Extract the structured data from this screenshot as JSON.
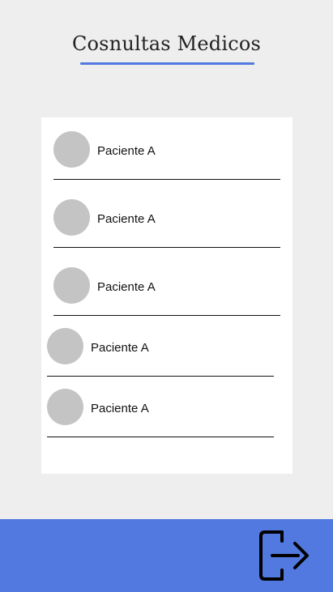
{
  "header": {
    "title": "Cosnultas Medicos"
  },
  "patients": [
    {
      "name": "Paciente A"
    },
    {
      "name": "Paciente A"
    },
    {
      "name": "Paciente A"
    },
    {
      "name": "Paciente A"
    },
    {
      "name": "Paciente A"
    }
  ],
  "bottom_bar": {
    "logout_icon": "logout-icon"
  },
  "colors": {
    "accent": "#5279e0",
    "background": "#eeeeee",
    "avatar": "#c4c4c4"
  }
}
